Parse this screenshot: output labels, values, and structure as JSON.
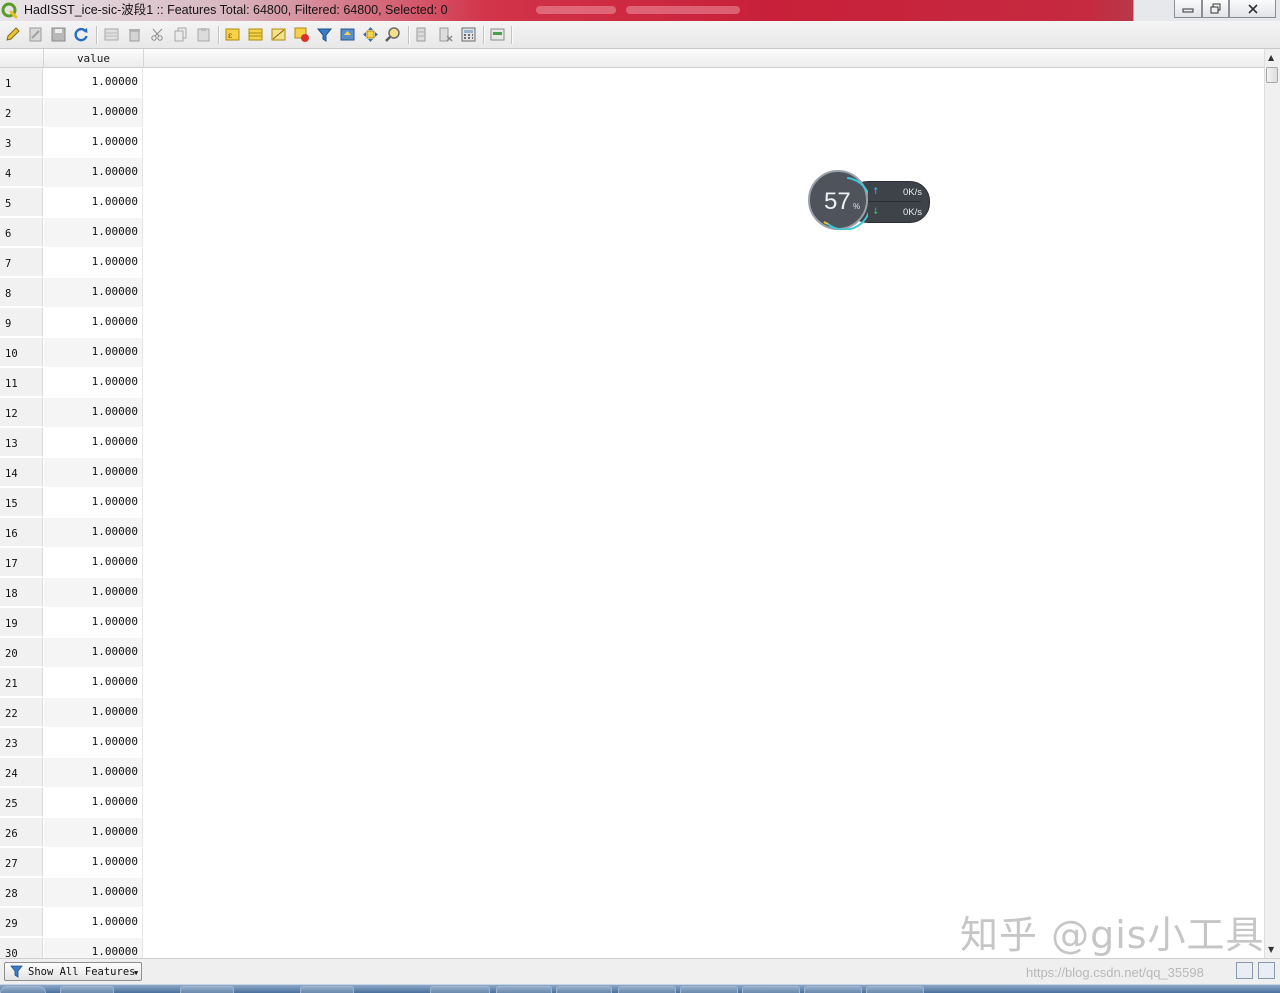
{
  "window": {
    "title": "HadISST_ice-sic-波段1 :: Features Total: 64800, Filtered: 64800, Selected: 0",
    "minimize_label": "–",
    "maximize_label": "▣",
    "close_label": "✕"
  },
  "toolbar": {
    "icons": [
      "pencil-icon",
      "edit-save-icon",
      "save-icon",
      "reload-icon",
      "add-feature-icon",
      "delete-icon",
      "cut-icon",
      "copy-icon",
      "paste-icon",
      "expression-select-icon",
      "select-all-icon",
      "invert-selection-icon",
      "deselect-icon",
      "filter-icon",
      "move-to-top-icon",
      "pan-to-selection-icon",
      "zoom-to-selection-icon",
      "new-field-icon",
      "delete-field-icon",
      "field-calculator-icon",
      "conditional-format-icon"
    ]
  },
  "table": {
    "column_header": "value",
    "rows": [
      {
        "id": "1",
        "value": "1.00000"
      },
      {
        "id": "2",
        "value": "1.00000"
      },
      {
        "id": "3",
        "value": "1.00000"
      },
      {
        "id": "4",
        "value": "1.00000"
      },
      {
        "id": "5",
        "value": "1.00000"
      },
      {
        "id": "6",
        "value": "1.00000"
      },
      {
        "id": "7",
        "value": "1.00000"
      },
      {
        "id": "8",
        "value": "1.00000"
      },
      {
        "id": "9",
        "value": "1.00000"
      },
      {
        "id": "10",
        "value": "1.00000"
      },
      {
        "id": "11",
        "value": "1.00000"
      },
      {
        "id": "12",
        "value": "1.00000"
      },
      {
        "id": "13",
        "value": "1.00000"
      },
      {
        "id": "14",
        "value": "1.00000"
      },
      {
        "id": "15",
        "value": "1.00000"
      },
      {
        "id": "16",
        "value": "1.00000"
      },
      {
        "id": "17",
        "value": "1.00000"
      },
      {
        "id": "18",
        "value": "1.00000"
      },
      {
        "id": "19",
        "value": "1.00000"
      },
      {
        "id": "20",
        "value": "1.00000"
      },
      {
        "id": "21",
        "value": "1.00000"
      },
      {
        "id": "22",
        "value": "1.00000"
      },
      {
        "id": "23",
        "value": "1.00000"
      },
      {
        "id": "24",
        "value": "1.00000"
      },
      {
        "id": "25",
        "value": "1.00000"
      },
      {
        "id": "26",
        "value": "1.00000"
      },
      {
        "id": "27",
        "value": "1.00000"
      },
      {
        "id": "28",
        "value": "1.00000"
      },
      {
        "id": "29",
        "value": "1.00000"
      },
      {
        "id": "30",
        "value": "1.00000"
      }
    ]
  },
  "speed_widget": {
    "percent": "57",
    "percent_sign": "%",
    "upload": "0K/s",
    "download": "0K/s",
    "up_arrow": "↑",
    "down_arrow": "↓"
  },
  "bottom_bar": {
    "filter_label": "Show All Features"
  },
  "watermark": {
    "zhihu": "知乎 @gis小工具",
    "url": "https://blog.csdn.net/qq_35598"
  },
  "colors": {
    "title_accent": "#c8203a",
    "qgis_green": "#5a9e2a"
  }
}
